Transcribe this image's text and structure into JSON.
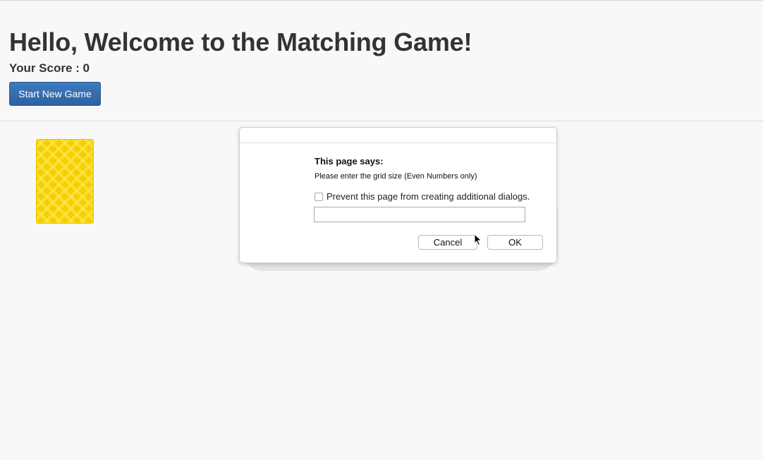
{
  "header": {
    "title": "Hello, Welcome to the Matching Game!",
    "score_label": "Your Score : ",
    "score_value": "0",
    "start_button_label": "Start New Game"
  },
  "board": {
    "card_color": "#f5cf00"
  },
  "dialog": {
    "heading": "This page says:",
    "message": "Please enter the grid size (Even Numbers only)",
    "prevent_label": "Prevent this page from creating additional dialogs.",
    "prevent_checked": false,
    "input_value": "",
    "cancel_label": "Cancel",
    "ok_label": "OK"
  },
  "colors": {
    "accent": "#2c62a0",
    "background": "#f8f8f8"
  }
}
